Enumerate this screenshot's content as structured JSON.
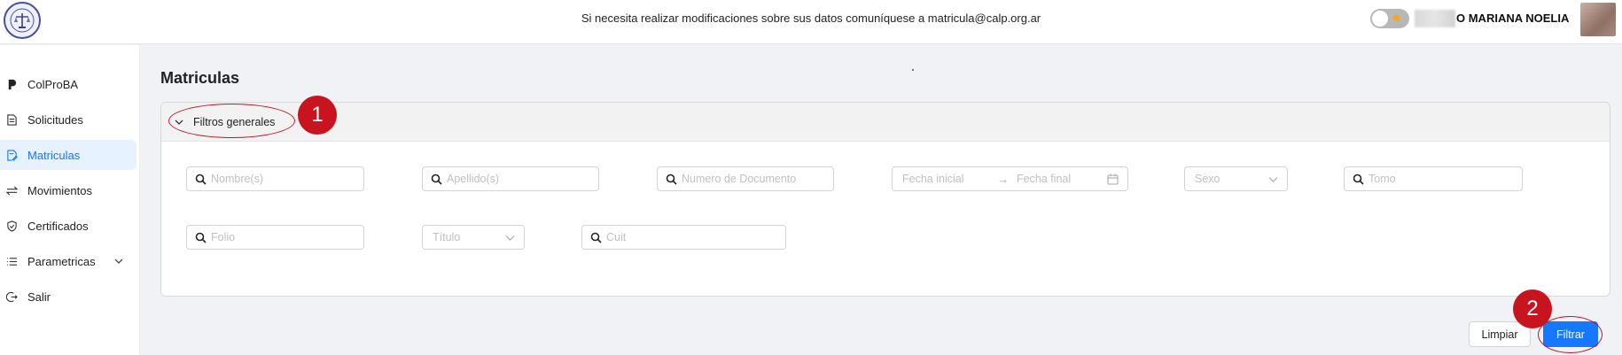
{
  "header": {
    "logo_icon": "college-seal-logo",
    "notice": "Si necesita realizar modificaciones sobre sus datos comuníquese a matricula@calp.org.ar",
    "theme_toggle_icon": "sun-icon",
    "username": "O MARIANA NOELIA"
  },
  "sidebar": {
    "items": [
      {
        "label": "ColProBA",
        "icon": "brand-p-icon"
      },
      {
        "label": "Solicitudes",
        "icon": "document-icon"
      },
      {
        "label": "Matriculas",
        "icon": "document-edit-icon",
        "active": true
      },
      {
        "label": "Movimientos",
        "icon": "swap-icon"
      },
      {
        "label": "Certificados",
        "icon": "shield-check-icon"
      },
      {
        "label": "Parametricas",
        "icon": "list-icon",
        "expandable": true
      },
      {
        "label": "Salir",
        "icon": "logout-icon"
      }
    ]
  },
  "main": {
    "title": "Matriculas",
    "filters": {
      "title": "Filtros generales",
      "nombre_placeholder": "Nombre(s)",
      "apellido_placeholder": "Apellido(s)",
      "documento_placeholder": "Numero de Documento",
      "fecha_inicial_placeholder": "Fecha inicial",
      "fecha_final_placeholder": "Fecha final",
      "sexo_placeholder": "Sexo",
      "tomo_placeholder": "Tomo",
      "folio_placeholder": "Folio",
      "titulo_placeholder": "Título",
      "cuit_placeholder": "Cuit"
    },
    "buttons": {
      "clear_label": "Limpiar",
      "filter_label": "Filtrar"
    },
    "annotations": {
      "step1": "1",
      "step2": "2"
    }
  },
  "colors": {
    "accent": "#1677ff",
    "annotation": "#c8141e",
    "active_bg": "#e6f2ff"
  }
}
